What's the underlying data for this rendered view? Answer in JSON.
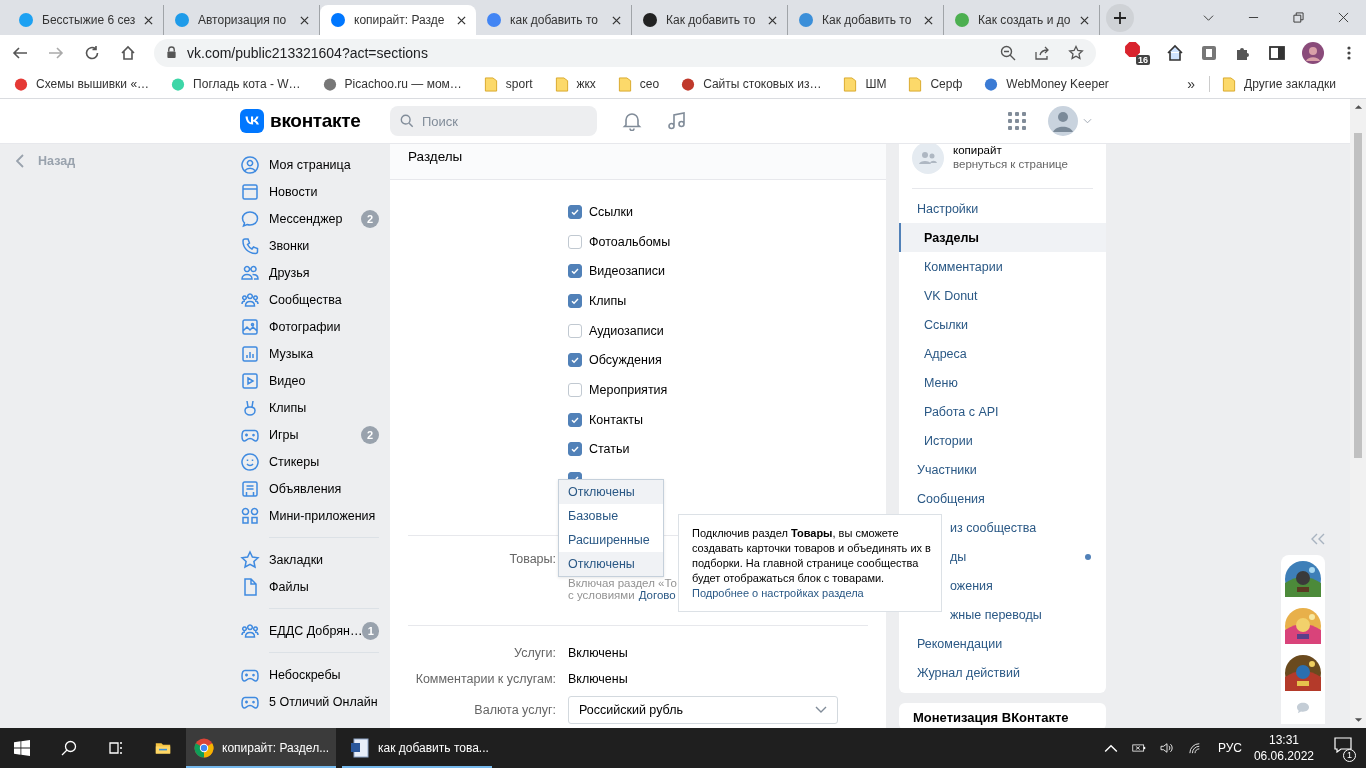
{
  "browser": {
    "tabs": [
      {
        "title": "Бесстыжие 6 сез",
        "selected": false
      },
      {
        "title": "Авторизация по",
        "selected": false
      },
      {
        "title": "копирайт: Разде",
        "selected": true
      },
      {
        "title": "как добавить то",
        "selected": false
      },
      {
        "title": "Как добавить то",
        "selected": false
      },
      {
        "title": "Как добавить то",
        "selected": false
      },
      {
        "title": "Как создать и до",
        "selected": false
      }
    ],
    "url": "vk.com/public213321604?act=sections",
    "extension_badge": "16",
    "bookmarks": [
      {
        "label": "Схемы вышивки «…",
        "kind": "site"
      },
      {
        "label": "Погладь кота - W…",
        "kind": "site"
      },
      {
        "label": "Picachoo.ru — мом…",
        "kind": "site"
      },
      {
        "label": "sport",
        "kind": "folder"
      },
      {
        "label": "жкх",
        "kind": "folder"
      },
      {
        "label": "сео",
        "kind": "folder"
      },
      {
        "label": "Сайты стоковых из…",
        "kind": "site"
      },
      {
        "label": "ШМ",
        "kind": "folder"
      },
      {
        "label": "Серф",
        "kind": "folder"
      },
      {
        "label": "WebMoney Keeper",
        "kind": "site"
      }
    ],
    "more": "»",
    "other_bookmarks": "Другие закладки"
  },
  "header": {
    "logo": "вконтакте",
    "search_placeholder": "Поиск"
  },
  "back": "Назад",
  "nav": [
    {
      "items": [
        {
          "label": "Моя страница"
        },
        {
          "label": "Новости"
        },
        {
          "label": "Мессенджер",
          "badge": "2"
        },
        {
          "label": "Звонки"
        },
        {
          "label": "Друзья"
        },
        {
          "label": "Сообщества"
        },
        {
          "label": "Фотографии"
        },
        {
          "label": "Музыка"
        },
        {
          "label": "Видео"
        },
        {
          "label": "Клипы"
        },
        {
          "label": "Игры",
          "badge": "2"
        },
        {
          "label": "Стикеры"
        },
        {
          "label": "Объявления"
        },
        {
          "label": "Мини-приложения"
        }
      ]
    },
    {
      "items": [
        {
          "label": "Закладки"
        },
        {
          "label": "Файлы"
        }
      ]
    },
    {
      "items": [
        {
          "label": "ЕДДС Добрян…",
          "badge": "1"
        }
      ]
    },
    {
      "items": [
        {
          "label": "Небоскребы"
        },
        {
          "label": "5 Отличий Онлайн"
        }
      ]
    }
  ],
  "sections": {
    "title": "Разделы",
    "checkboxes": [
      {
        "label": "Ссылки",
        "checked": true
      },
      {
        "label": "Фотоальбомы",
        "checked": false
      },
      {
        "label": "Видеозаписи",
        "checked": true
      },
      {
        "label": "Клипы",
        "checked": true
      },
      {
        "label": "Аудиозаписи",
        "checked": false
      },
      {
        "label": "Обсуждения",
        "checked": true
      },
      {
        "label": "Мероприятия",
        "checked": false
      },
      {
        "label": "Контакты",
        "checked": true
      },
      {
        "label": "Статьи",
        "checked": true
      },
      {
        "checked": true
      }
    ],
    "goods": {
      "label": "Товары:",
      "options": [
        {
          "label": "Отключены",
          "highlighted": true
        },
        {
          "label": "Базовые",
          "highlighted": false
        },
        {
          "label": "Расширенные",
          "highlighted": false
        },
        {
          "label": "Отключены",
          "highlighted": true
        }
      ],
      "note": "Включая раздел «То",
      "note_line2": "с условиями",
      "note_link": "Догово"
    },
    "tooltip": {
      "text": "Подключив раздел **Товары**, вы сможете создавать карточки товаров и объединять их в подборки. На главной странице сообщества будет отображаться блок с товарами.",
      "link": "Подробнее о настройках раздела"
    },
    "fields": [
      {
        "label": "Услуги:",
        "value": "Включены",
        "kind": "text"
      },
      {
        "label": "Комментарии к услугам:",
        "value": "Включены",
        "kind": "text"
      },
      {
        "label": "Валюта услуг:",
        "value": "Российский рубль",
        "kind": "select"
      }
    ]
  },
  "community": {
    "name": "копирайт",
    "link": "вернуться к странице"
  },
  "menu": [
    {
      "label": "Настройки",
      "selected": false,
      "covered": false,
      "dot": false,
      "children": [
        {
          "label": "Разделы",
          "selected": true,
          "covered": false,
          "dot": false
        },
        {
          "label": "Комментарии",
          "selected": false,
          "covered": false,
          "dot": false
        },
        {
          "label": "VK Donut",
          "selected": false,
          "covered": false,
          "dot": false
        },
        {
          "label": "Ссылки",
          "selected": false,
          "covered": false,
          "dot": false
        },
        {
          "label": "Адреса",
          "selected": false,
          "covered": false,
          "dot": false
        },
        {
          "label": "Меню",
          "selected": false,
          "covered": false,
          "dot": false
        },
        {
          "label": "Работа с API",
          "selected": false,
          "covered": false,
          "dot": false
        },
        {
          "label": "Истории",
          "selected": false,
          "covered": false,
          "dot": false
        }
      ]
    },
    {
      "label": "Участники",
      "selected": false,
      "covered": false,
      "dot": false
    },
    {
      "label": "Сообщения",
      "selected": false,
      "covered": false,
      "dot": false
    },
    {
      "label": "из сообщества",
      "selected": false,
      "covered": true,
      "dot": false
    },
    {
      "label": "ды",
      "selected": false,
      "covered": true,
      "dot": true
    },
    {
      "label": "ожения",
      "selected": false,
      "covered": true,
      "dot": false
    },
    {
      "label": "жные переводы",
      "selected": false,
      "covered": true,
      "dot": false
    },
    {
      "label": "Рекомендации",
      "selected": false,
      "covered": false,
      "dot": false
    },
    {
      "label": "Журнал действий",
      "selected": false,
      "covered": false,
      "dot": false
    }
  ],
  "monetization": "Монетизация ВКонтакте",
  "taskbar": {
    "apps": [
      {
        "label": "копирайт: Раздел...",
        "selected": true
      },
      {
        "label": "как добавить това...",
        "selected": false
      }
    ],
    "language": "РУС",
    "time": "13:31",
    "date": "06.06.2022",
    "notifications": "1"
  }
}
